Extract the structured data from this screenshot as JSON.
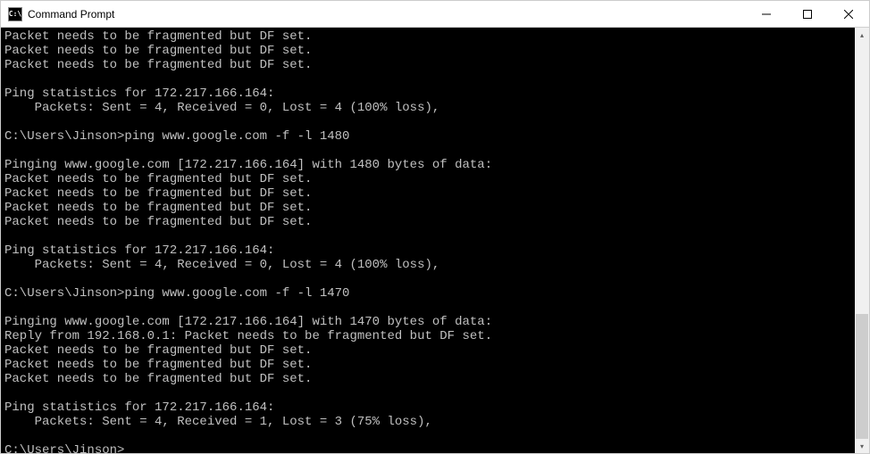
{
  "window": {
    "title": "Command Prompt",
    "icon_label": "C:\\"
  },
  "terminal": {
    "lines": [
      "Packet needs to be fragmented but DF set.",
      "Packet needs to be fragmented but DF set.",
      "Packet needs to be fragmented but DF set.",
      "",
      "Ping statistics for 172.217.166.164:",
      "    Packets: Sent = 4, Received = 0, Lost = 4 (100% loss),",
      "",
      "C:\\Users\\Jinson>ping www.google.com -f -l 1480",
      "",
      "Pinging www.google.com [172.217.166.164] with 1480 bytes of data:",
      "Packet needs to be fragmented but DF set.",
      "Packet needs to be fragmented but DF set.",
      "Packet needs to be fragmented but DF set.",
      "Packet needs to be fragmented but DF set.",
      "",
      "Ping statistics for 172.217.166.164:",
      "    Packets: Sent = 4, Received = 0, Lost = 4 (100% loss),",
      "",
      "C:\\Users\\Jinson>ping www.google.com -f -l 1470",
      "",
      "Pinging www.google.com [172.217.166.164] with 1470 bytes of data:",
      "Reply from 192.168.0.1: Packet needs to be fragmented but DF set.",
      "Packet needs to be fragmented but DF set.",
      "Packet needs to be fragmented but DF set.",
      "Packet needs to be fragmented but DF set.",
      "",
      "Ping statistics for 172.217.166.164:",
      "    Packets: Sent = 4, Received = 1, Lost = 3 (75% loss),",
      "",
      "C:\\Users\\Jinson>"
    ]
  }
}
